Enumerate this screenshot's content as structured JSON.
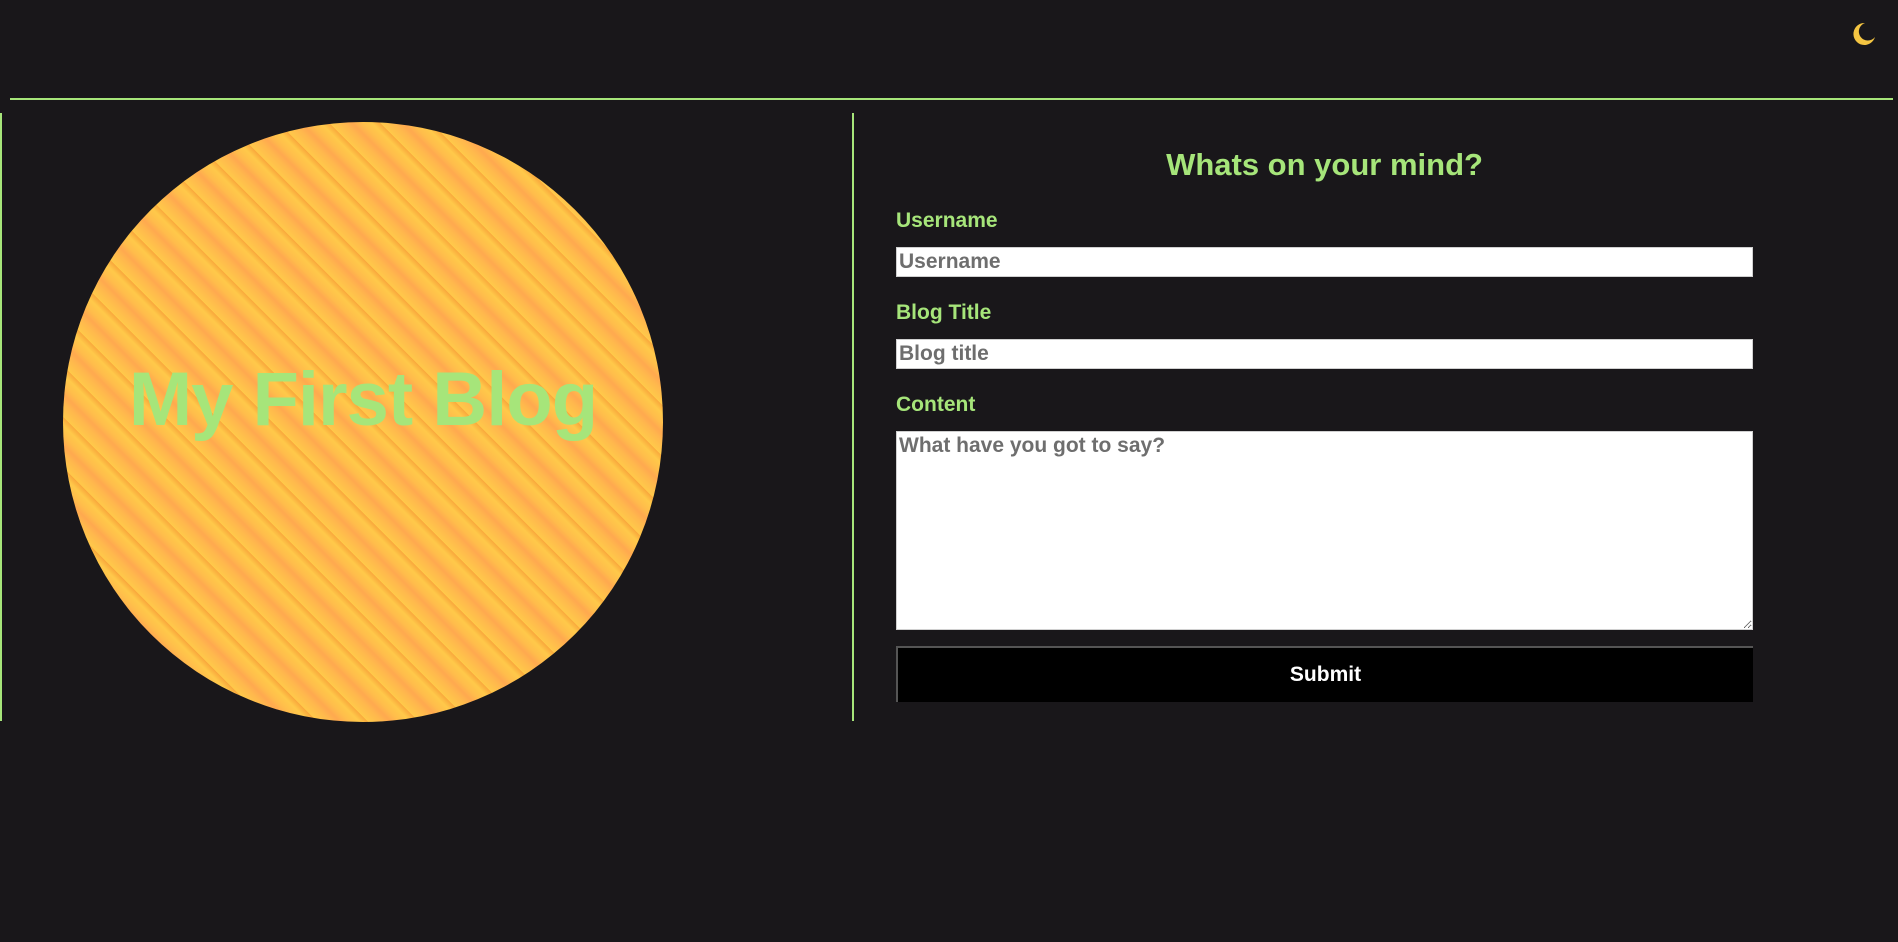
{
  "header": {
    "theme_toggle_icon": "moon-icon",
    "accent_color": "#a6e57a",
    "background_color": "#19171a"
  },
  "hero": {
    "title": "My First Blog",
    "circle_colors": [
      "#ffc94a",
      "#ffa94f",
      "#f9a83c"
    ]
  },
  "form": {
    "heading": "Whats on your mind?",
    "username": {
      "label": "Username",
      "placeholder": "Username",
      "value": ""
    },
    "blog_title": {
      "label": "Blog Title",
      "placeholder": "Blog title",
      "value": ""
    },
    "content": {
      "label": "Content",
      "placeholder": "What have you got to say?",
      "value": ""
    },
    "submit_label": "Submit"
  }
}
